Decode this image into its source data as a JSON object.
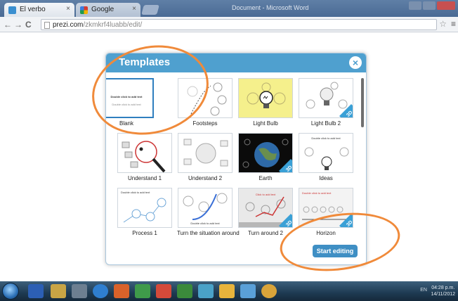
{
  "browser": {
    "tabs": [
      {
        "label": "El verbo"
      },
      {
        "label": "Google"
      }
    ],
    "window_title": "Document - Microsoft Word",
    "url_domain": "prezi.com",
    "url_path": "/zkmkrf4luabb/edit/"
  },
  "dialog": {
    "title": "Templates",
    "templates": [
      "Blank",
      "Footsteps",
      "Light Bulb",
      "Light Bulb 2",
      "Understand 1",
      "Understand 2",
      "Earth",
      "Ideas",
      "Process 1",
      "Turn the situation around",
      "Turn around 2",
      "Horizon"
    ],
    "start_button": "Start editing"
  },
  "taskbar": {
    "language": "EN",
    "time": "04:28 p.m.",
    "date": "14/11/2012"
  },
  "colors": {
    "dialog_header": "#4fa0cf",
    "start_button": "#3f8fc4",
    "annotation": "#f08a3a"
  }
}
